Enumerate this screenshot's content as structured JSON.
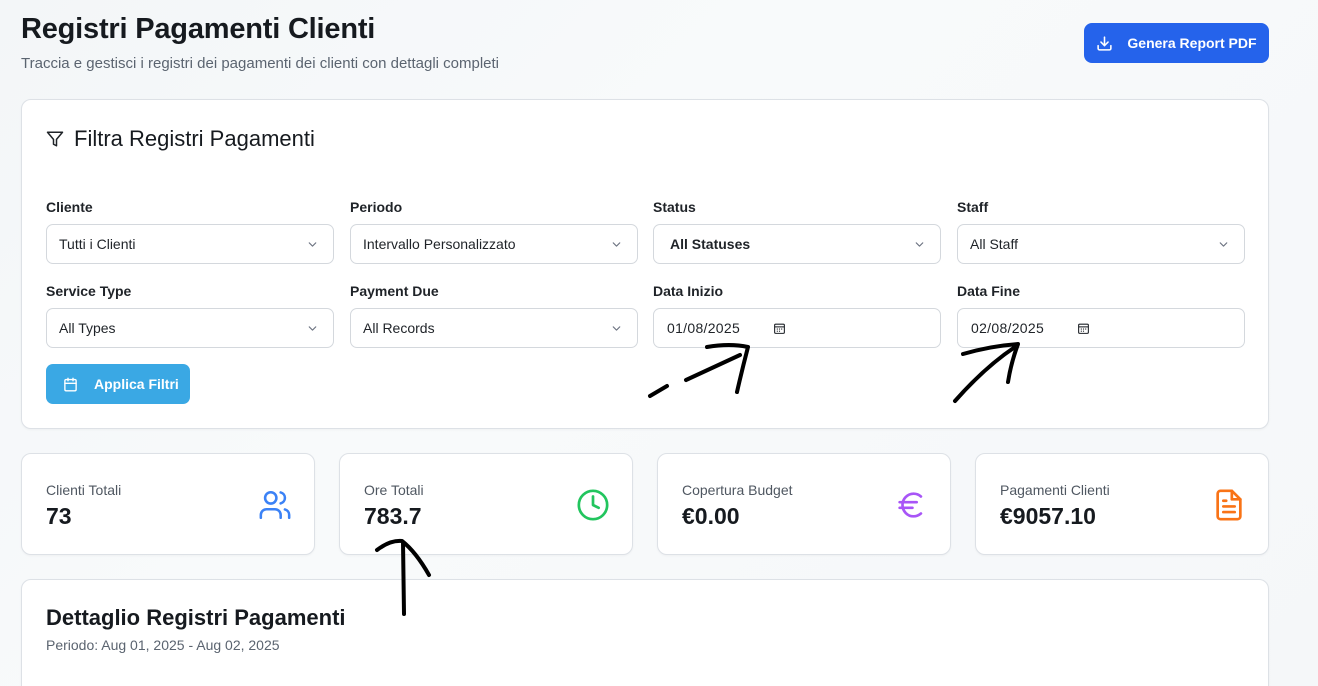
{
  "header": {
    "title": "Registri Pagamenti Clienti",
    "subtitle": "Traccia e gestisci i registri dei pagamenti dei clienti con dettagli completi",
    "report_button": "Genera Report PDF"
  },
  "filters": {
    "title": "Filtra Registri Pagamenti",
    "cliente": {
      "label": "Cliente",
      "value": "Tutti i Clienti"
    },
    "periodo": {
      "label": "Periodo",
      "value": "Intervallo Personalizzato"
    },
    "status": {
      "label": "Status",
      "value": "All Statuses"
    },
    "staff": {
      "label": "Staff",
      "value": "All Staff"
    },
    "service_type": {
      "label": "Service Type",
      "value": "All Types"
    },
    "payment_due": {
      "label": "Payment Due",
      "value": "All Records"
    },
    "data_inizio": {
      "label": "Data Inizio",
      "value": "01/08/2025"
    },
    "data_fine": {
      "label": "Data Fine",
      "value": "02/08/2025"
    },
    "apply_button": "Applica Filtri"
  },
  "stats": [
    {
      "label": "Clienti Totali",
      "value": "73",
      "icon": "users-icon",
      "color": "#3b82f6"
    },
    {
      "label": "Ore Totali",
      "value": "783.7",
      "icon": "clock-icon",
      "color": "#22c55e"
    },
    {
      "label": "Copertura Budget",
      "value": "€0.00",
      "icon": "euro-icon",
      "color": "#a855f7"
    },
    {
      "label": "Pagamenti Clienti",
      "value": "€9057.10",
      "icon": "document-icon",
      "color": "#f97316"
    }
  ],
  "detail": {
    "title": "Dettaglio Registri Pagamenti",
    "period": "Periodo: Aug 01, 2025 - Aug 02, 2025"
  },
  "colors": {
    "primary": "#2563eb",
    "apply": "#3aa8e4"
  }
}
